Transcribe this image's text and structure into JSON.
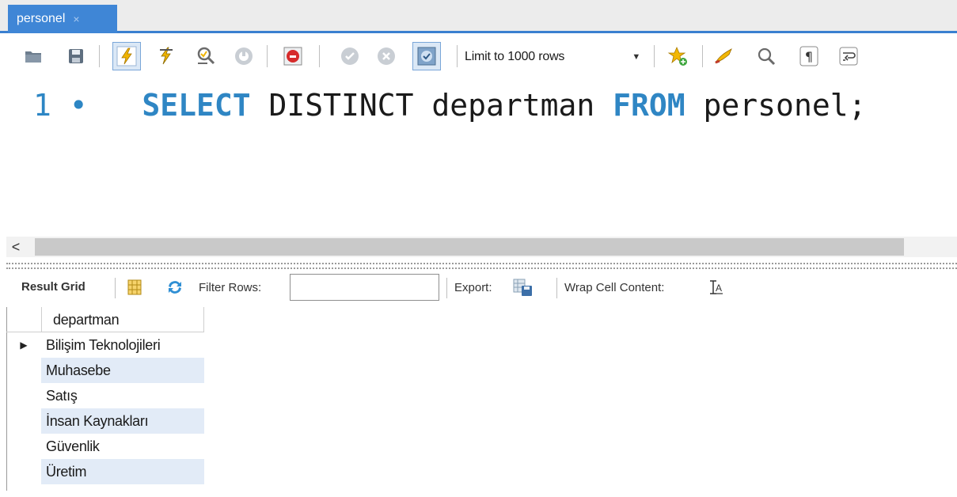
{
  "tab": {
    "label": "personel",
    "close_glyph": "×"
  },
  "toolbar": {
    "limit_label": "Limit to 1000 rows",
    "icons": [
      "folder-open-icon",
      "save-icon",
      "execute-icon",
      "execute-current-icon",
      "explain-icon",
      "stop-icon",
      "toggle-error-icon",
      "commit-icon",
      "rollback-icon",
      "autocommit-icon",
      "add-snippet-icon",
      "beautify-icon",
      "find-icon",
      "invisible-chars-icon",
      "word-wrap-icon"
    ]
  },
  "editor": {
    "line_number": "1",
    "line_marker": "•",
    "tokens": [
      {
        "text": "SELECT",
        "type": "keyword"
      },
      {
        "text": " DISTINCT departman ",
        "type": "plain"
      },
      {
        "text": "FROM",
        "type": "keyword"
      },
      {
        "text": " personel;",
        "type": "plain"
      }
    ]
  },
  "scrollbar": {
    "left_arrow": "<"
  },
  "result_toolbar": {
    "result_grid_label": "Result Grid",
    "filter_label": "Filter Rows:",
    "filter_value": "",
    "export_label": "Export:",
    "wrap_label": "Wrap Cell Content:"
  },
  "grid": {
    "column": "departman",
    "rows": [
      "Bilişim Teknolojileri",
      "Muhasebe",
      "Satış",
      "İnsan Kaynakları",
      "Güvenlik",
      "Üretim"
    ],
    "selected_row": 0
  },
  "colors": {
    "tab_active": "#3f86d6",
    "keyword": "#2f86c4",
    "row_highlight": "#e2ebf7"
  }
}
